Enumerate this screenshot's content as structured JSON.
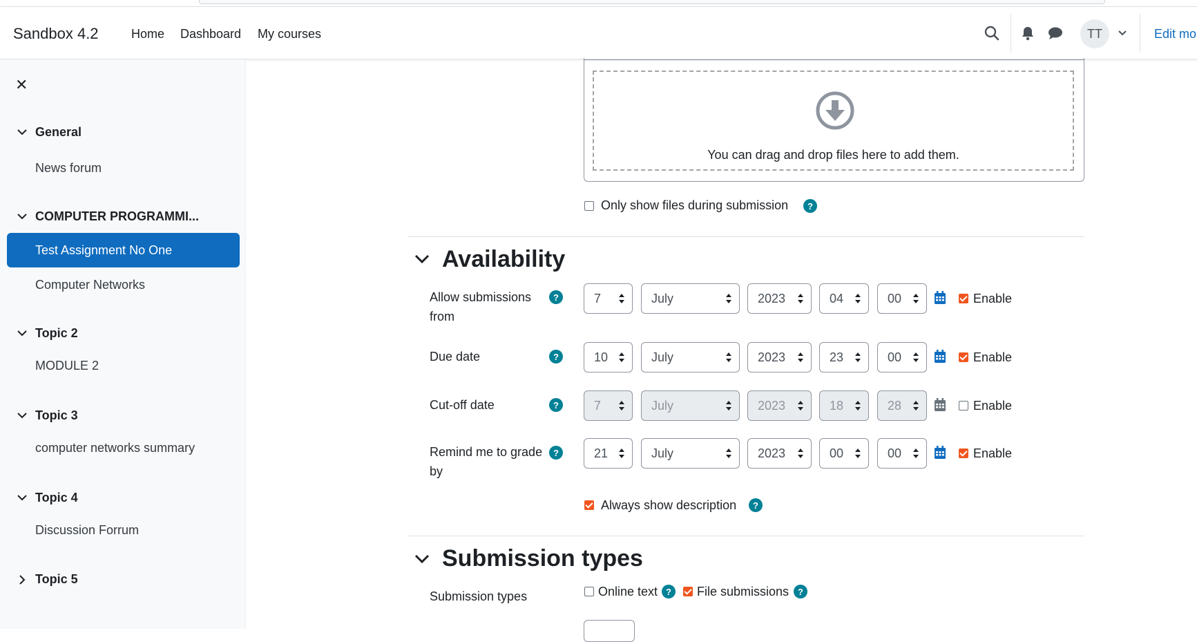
{
  "navbar": {
    "brand": "Sandbox 4.2",
    "links": [
      "Home",
      "Dashboard",
      "My courses"
    ],
    "avatar_initials": "TT",
    "edit_mode_label": "Edit mo",
    "icons": [
      "search-icon",
      "bell-icon",
      "chat-icon",
      "chevron-down-icon"
    ]
  },
  "drawer": {
    "close_icon": "close-icon",
    "sections": [
      {
        "title": "General",
        "expanded": true,
        "items": [
          "News forum"
        ]
      },
      {
        "title": "COMPUTER PROGRAMMI...",
        "expanded": true,
        "items": [
          "Test Assignment No One",
          "Computer Networks"
        ],
        "active_item": "Test Assignment No One"
      },
      {
        "title": "Topic 2",
        "expanded": true,
        "items": [
          "MODULE 2"
        ]
      },
      {
        "title": "Topic 3",
        "expanded": true,
        "items": [
          "computer networks summary"
        ]
      },
      {
        "title": "Topic 4",
        "expanded": true,
        "items": [
          "Discussion Forrum"
        ]
      },
      {
        "title": "Topic 5",
        "expanded": false,
        "items": []
      }
    ]
  },
  "files": {
    "dropzone_text": "You can drag and drop files here to add them.",
    "only_show_files_label": "Only show files during submission",
    "only_show_files_checked": false
  },
  "availability": {
    "title": "Availability",
    "enable_label": "Enable",
    "rows": [
      {
        "label_line1": "Allow submissions",
        "label_line2": "from",
        "day": "7",
        "month": "July",
        "year": "2023",
        "hour": "04",
        "minute": "00",
        "enabled": true
      },
      {
        "label_line1": "Due date",
        "label_line2": "",
        "day": "10",
        "month": "July",
        "year": "2023",
        "hour": "23",
        "minute": "00",
        "enabled": true
      },
      {
        "label_line1": "Cut-off date",
        "label_line2": "",
        "day": "7",
        "month": "July",
        "year": "2023",
        "hour": "18",
        "minute": "28",
        "enabled": false
      },
      {
        "label_line1": "Remind me to grade",
        "label_line2": "by",
        "day": "21",
        "month": "July",
        "year": "2023",
        "hour": "00",
        "minute": "00",
        "enabled": true
      }
    ],
    "always_show_description_label": "Always show description",
    "always_show_description_checked": true
  },
  "submission_types": {
    "title": "Submission types",
    "row_label": "Submission types",
    "online_text_label": "Online text",
    "online_text_checked": false,
    "file_submissions_label": "File submissions",
    "file_submissions_checked": true
  },
  "colors": {
    "primary": "#0f6cbf",
    "help": "#008196",
    "checkbox_on": "#f0551f"
  }
}
